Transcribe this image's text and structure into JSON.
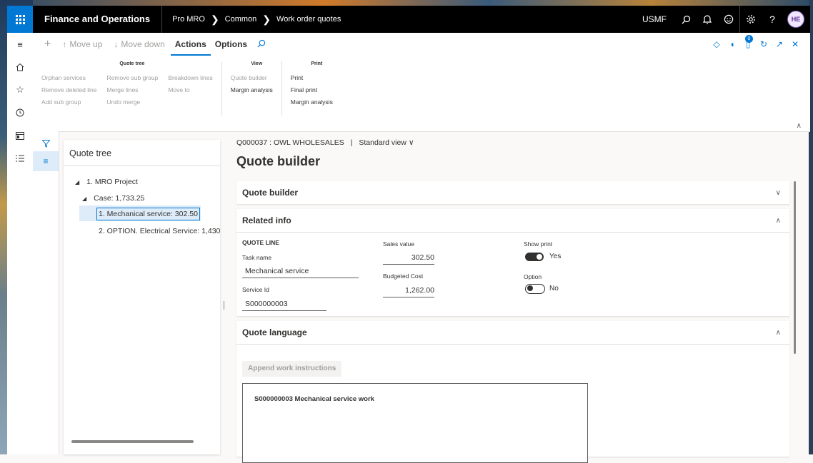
{
  "topbar": {
    "app_title": "Finance and Operations",
    "breadcrumbs": [
      "Pro MRO",
      "Common",
      "Work order quotes"
    ],
    "company": "USMF",
    "avatar_initials": "HE"
  },
  "action_pane": {
    "new_icon": "+",
    "move_up": "Move up",
    "move_down": "Move down",
    "tabs": [
      "Actions",
      "Options"
    ],
    "active_tab": "Actions",
    "notification_count": "0",
    "groups": {
      "quote_tree": {
        "title": "Quote tree",
        "col1": [
          "Orphan services",
          "Remove deleted line",
          "Add sub group"
        ],
        "col2": [
          "Remove sub group",
          "Merge lines",
          "Undo merge"
        ],
        "col3": [
          "Breakdown lines",
          "Move to"
        ]
      },
      "view": {
        "title": "View",
        "items": [
          "Quote builder",
          "Margin analysis"
        ]
      },
      "print": {
        "title": "Print",
        "items": [
          "Print",
          "Final print",
          "Margin analysis"
        ]
      }
    }
  },
  "tree": {
    "title": "Quote tree",
    "nodes": [
      "1. MRO Project",
      "Case: 1,733.25",
      "1. Mechanical service: 302.50",
      "2. OPTION. Electrical Service: 1,430"
    ],
    "selected_index": 2
  },
  "main": {
    "record": "Q000037 : OWL WHOLESALES",
    "separator": "|",
    "view": "Standard view",
    "title": "Quote builder",
    "sections": {
      "quote_builder": "Quote builder",
      "related_info": "Related info",
      "quote_language": "Quote language"
    },
    "quote_line": {
      "heading": "QUOTE LINE",
      "task_name_label": "Task name",
      "task_name": "Mechanical service",
      "service_id_label": "Service Id",
      "service_id": "S000000003",
      "sales_value_label": "Sales value",
      "sales_value": "302.50",
      "budgeted_cost_label": "Budgeted Cost",
      "budgeted_cost": "1,262.00",
      "show_print_label": "Show print",
      "show_print_value": "Yes",
      "show_print_on": true,
      "option_label": "Option",
      "option_value": "No",
      "option_on": false
    },
    "append_button": "Append work instructions",
    "language_text": "S000000003 Mechanical service work"
  }
}
